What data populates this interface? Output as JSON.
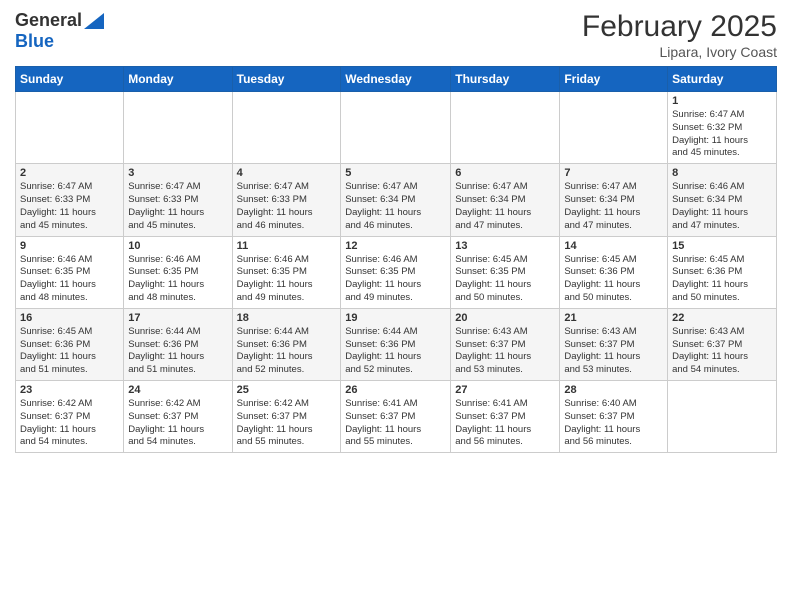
{
  "header": {
    "logo_general": "General",
    "logo_blue": "Blue",
    "month_title": "February 2025",
    "location": "Lipara, Ivory Coast"
  },
  "weekdays": [
    "Sunday",
    "Monday",
    "Tuesday",
    "Wednesday",
    "Thursday",
    "Friday",
    "Saturday"
  ],
  "weeks": [
    [
      {
        "day": "",
        "info": ""
      },
      {
        "day": "",
        "info": ""
      },
      {
        "day": "",
        "info": ""
      },
      {
        "day": "",
        "info": ""
      },
      {
        "day": "",
        "info": ""
      },
      {
        "day": "",
        "info": ""
      },
      {
        "day": "1",
        "info": "Sunrise: 6:47 AM\nSunset: 6:32 PM\nDaylight: 11 hours\nand 45 minutes."
      }
    ],
    [
      {
        "day": "2",
        "info": "Sunrise: 6:47 AM\nSunset: 6:33 PM\nDaylight: 11 hours\nand 45 minutes."
      },
      {
        "day": "3",
        "info": "Sunrise: 6:47 AM\nSunset: 6:33 PM\nDaylight: 11 hours\nand 45 minutes."
      },
      {
        "day": "4",
        "info": "Sunrise: 6:47 AM\nSunset: 6:33 PM\nDaylight: 11 hours\nand 46 minutes."
      },
      {
        "day": "5",
        "info": "Sunrise: 6:47 AM\nSunset: 6:34 PM\nDaylight: 11 hours\nand 46 minutes."
      },
      {
        "day": "6",
        "info": "Sunrise: 6:47 AM\nSunset: 6:34 PM\nDaylight: 11 hours\nand 47 minutes."
      },
      {
        "day": "7",
        "info": "Sunrise: 6:47 AM\nSunset: 6:34 PM\nDaylight: 11 hours\nand 47 minutes."
      },
      {
        "day": "8",
        "info": "Sunrise: 6:46 AM\nSunset: 6:34 PM\nDaylight: 11 hours\nand 47 minutes."
      }
    ],
    [
      {
        "day": "9",
        "info": "Sunrise: 6:46 AM\nSunset: 6:35 PM\nDaylight: 11 hours\nand 48 minutes."
      },
      {
        "day": "10",
        "info": "Sunrise: 6:46 AM\nSunset: 6:35 PM\nDaylight: 11 hours\nand 48 minutes."
      },
      {
        "day": "11",
        "info": "Sunrise: 6:46 AM\nSunset: 6:35 PM\nDaylight: 11 hours\nand 49 minutes."
      },
      {
        "day": "12",
        "info": "Sunrise: 6:46 AM\nSunset: 6:35 PM\nDaylight: 11 hours\nand 49 minutes."
      },
      {
        "day": "13",
        "info": "Sunrise: 6:45 AM\nSunset: 6:35 PM\nDaylight: 11 hours\nand 50 minutes."
      },
      {
        "day": "14",
        "info": "Sunrise: 6:45 AM\nSunset: 6:36 PM\nDaylight: 11 hours\nand 50 minutes."
      },
      {
        "day": "15",
        "info": "Sunrise: 6:45 AM\nSunset: 6:36 PM\nDaylight: 11 hours\nand 50 minutes."
      }
    ],
    [
      {
        "day": "16",
        "info": "Sunrise: 6:45 AM\nSunset: 6:36 PM\nDaylight: 11 hours\nand 51 minutes."
      },
      {
        "day": "17",
        "info": "Sunrise: 6:44 AM\nSunset: 6:36 PM\nDaylight: 11 hours\nand 51 minutes."
      },
      {
        "day": "18",
        "info": "Sunrise: 6:44 AM\nSunset: 6:36 PM\nDaylight: 11 hours\nand 52 minutes."
      },
      {
        "day": "19",
        "info": "Sunrise: 6:44 AM\nSunset: 6:36 PM\nDaylight: 11 hours\nand 52 minutes."
      },
      {
        "day": "20",
        "info": "Sunrise: 6:43 AM\nSunset: 6:37 PM\nDaylight: 11 hours\nand 53 minutes."
      },
      {
        "day": "21",
        "info": "Sunrise: 6:43 AM\nSunset: 6:37 PM\nDaylight: 11 hours\nand 53 minutes."
      },
      {
        "day": "22",
        "info": "Sunrise: 6:43 AM\nSunset: 6:37 PM\nDaylight: 11 hours\nand 54 minutes."
      }
    ],
    [
      {
        "day": "23",
        "info": "Sunrise: 6:42 AM\nSunset: 6:37 PM\nDaylight: 11 hours\nand 54 minutes."
      },
      {
        "day": "24",
        "info": "Sunrise: 6:42 AM\nSunset: 6:37 PM\nDaylight: 11 hours\nand 54 minutes."
      },
      {
        "day": "25",
        "info": "Sunrise: 6:42 AM\nSunset: 6:37 PM\nDaylight: 11 hours\nand 55 minutes."
      },
      {
        "day": "26",
        "info": "Sunrise: 6:41 AM\nSunset: 6:37 PM\nDaylight: 11 hours\nand 55 minutes."
      },
      {
        "day": "27",
        "info": "Sunrise: 6:41 AM\nSunset: 6:37 PM\nDaylight: 11 hours\nand 56 minutes."
      },
      {
        "day": "28",
        "info": "Sunrise: 6:40 AM\nSunset: 6:37 PM\nDaylight: 11 hours\nand 56 minutes."
      },
      {
        "day": "",
        "info": ""
      }
    ]
  ]
}
